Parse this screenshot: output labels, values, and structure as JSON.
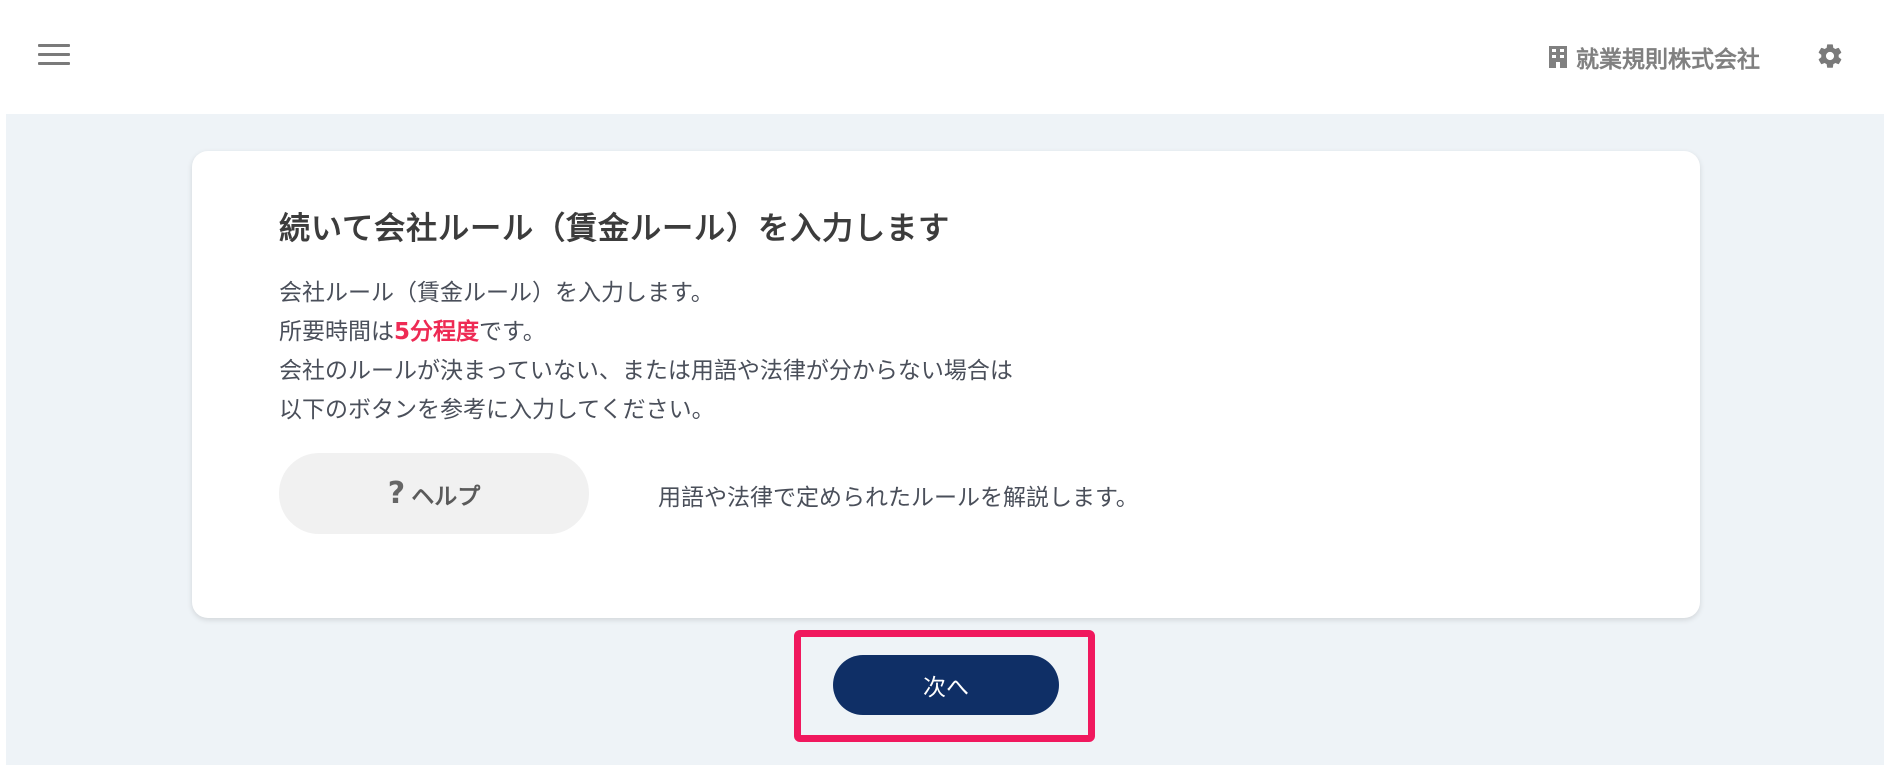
{
  "header": {
    "company_name": "就業規則株式会社",
    "menu_icon": "hamburger-menu-icon",
    "building_icon": "building-icon",
    "settings_icon": "gear-icon"
  },
  "card": {
    "title": "続いて会社ルール（賃金ルール）を入力します",
    "desc_line1": "会社ルール（賃金ルール）を入力します。",
    "desc_line2_prefix": "所要時間は",
    "desc_line2_highlight": "5分程度",
    "desc_line2_suffix": "です。",
    "desc_line3": "会社のルールが決まっていない、または用語や法律が分からない場合は",
    "desc_line4": "以下のボタンを参考に入力してください。",
    "help_button_label": "ヘルプ",
    "help_button_icon": "?",
    "help_description": "用語や法律で定められたルールを解説します。"
  },
  "footer": {
    "next_button_label": "次へ"
  },
  "colors": {
    "accent_highlight": "#ee2a54",
    "primary_button": "#0f2f66",
    "annotation_box": "#f0185e",
    "background": "#eef3f7"
  }
}
